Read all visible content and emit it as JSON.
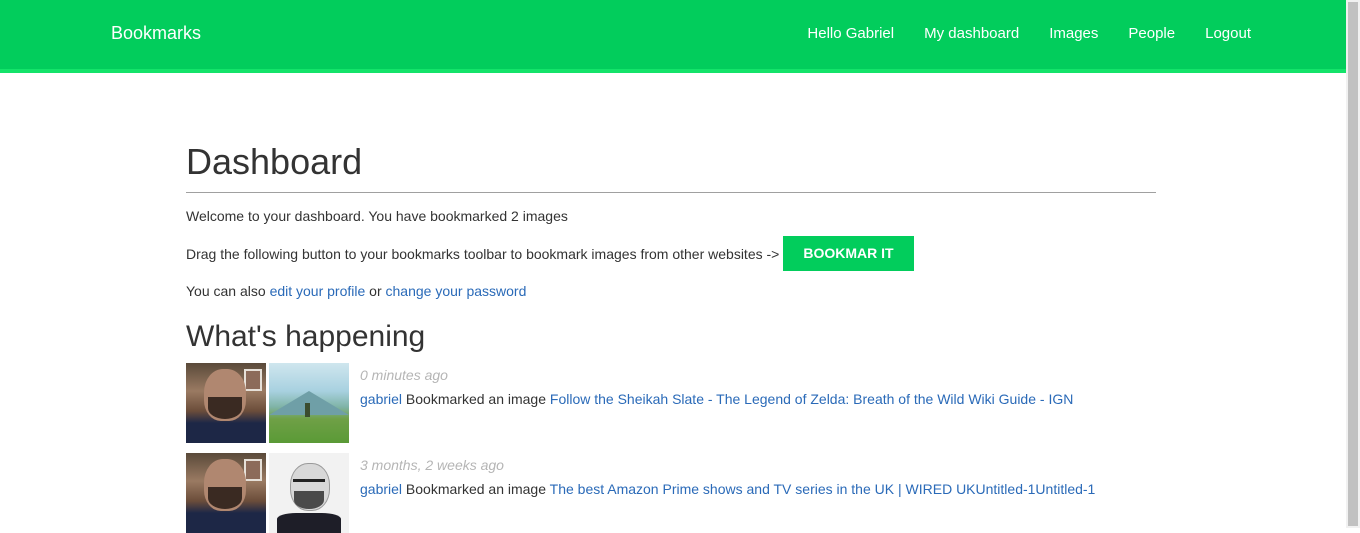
{
  "header": {
    "brand": "Bookmarks",
    "nav": [
      {
        "label": "Hello Gabriel"
      },
      {
        "label": "My dashboard"
      },
      {
        "label": "Images"
      },
      {
        "label": "People"
      },
      {
        "label": "Logout"
      }
    ],
    "background_color": "#02cd5c"
  },
  "main": {
    "title": "Dashboard",
    "welcome": "Welcome to your dashboard. You have bookmarked 2 images",
    "drag_text": "Drag the following button to your bookmarks toolbar to bookmark images from other websites ->",
    "bookmarklet_label": "BOOKMAR IT",
    "also_prefix": "You can also ",
    "edit_profile_link": "edit your profile",
    "or_text": " or ",
    "change_password_link": "change your password",
    "section_title": "What's happening",
    "actions": [
      {
        "date": "0 minutes ago",
        "user": "gabriel",
        "verb": " Bookmarked an image ",
        "target": "Follow the Sheikah Slate - The Legend of Zelda: Breath of the Wild Wiki Guide - IGN",
        "thumbnails": [
          "user-photo",
          "zelda-landscape"
        ]
      },
      {
        "date": "3 months, 2 weeks ago",
        "user": "gabriel",
        "verb": " Bookmarked an image ",
        "target": "The best Amazon Prime shows and TV series in the UK | WIRED UKUntitled-1Untitled-1",
        "thumbnails": [
          "user-photo",
          "man-portrait"
        ]
      }
    ]
  },
  "colors": {
    "accent": "#02cd5c",
    "link": "#2a6ab8",
    "muted": "#b5b5b5"
  }
}
